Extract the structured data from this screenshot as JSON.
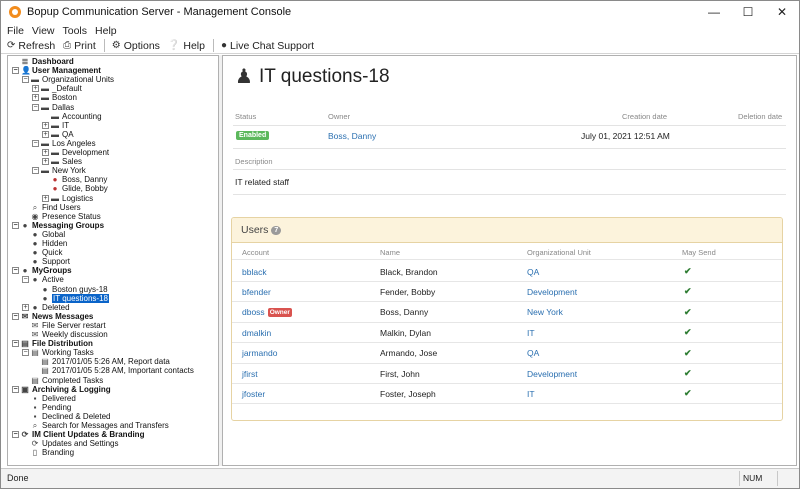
{
  "window": {
    "title": "Bopup Communication Server - Management Console"
  },
  "menu": [
    "File",
    "View",
    "Tools",
    "Help"
  ],
  "toolbar": {
    "refresh": "Refresh",
    "print": "Print",
    "options": "Options",
    "help": "Help",
    "live_chat": "Live Chat Support"
  },
  "tree": [
    {
      "label": "Dashboard",
      "bold": true,
      "icon": "≣",
      "exp": ""
    },
    {
      "label": "User Management",
      "bold": true,
      "icon": "👤",
      "exp": "−"
    },
    {
      "label": "Organizational Units",
      "icon": "▬",
      "exp": "−"
    },
    {
      "label": "_Default",
      "icon": "▬",
      "exp": "+"
    },
    {
      "label": "Boston",
      "icon": "▬",
      "exp": "+"
    },
    {
      "label": "Dallas",
      "icon": "▬",
      "exp": "−"
    },
    {
      "label": "Accounting",
      "icon": "▬",
      "exp": ""
    },
    {
      "label": "IT",
      "icon": "▬",
      "exp": "+"
    },
    {
      "label": "QA",
      "icon": "▬",
      "exp": "+"
    },
    {
      "label": "Los Angeles",
      "icon": "▬",
      "exp": "−"
    },
    {
      "label": "Development",
      "icon": "▬",
      "exp": "+"
    },
    {
      "label": "Sales",
      "icon": "▬",
      "exp": "+"
    },
    {
      "label": "New York",
      "icon": "▬",
      "exp": "−"
    },
    {
      "label": "Boss, Danny",
      "icon": "●",
      "exp": "",
      "red": true
    },
    {
      "label": "Glide, Bobby",
      "icon": "●",
      "exp": "",
      "red": true
    },
    {
      "label": "Logistics",
      "icon": "▬",
      "exp": "+"
    },
    {
      "label": "Find Users",
      "icon": "⌕",
      "exp": ""
    },
    {
      "label": "Presence Status",
      "icon": "◉",
      "exp": ""
    },
    {
      "label": "Messaging Groups",
      "bold": true,
      "icon": "●",
      "exp": "−"
    },
    {
      "label": "Global",
      "icon": "●",
      "exp": ""
    },
    {
      "label": "Hidden",
      "icon": "●",
      "exp": ""
    },
    {
      "label": "Quick",
      "icon": "●",
      "exp": ""
    },
    {
      "label": "Support",
      "icon": "●",
      "exp": ""
    },
    {
      "label": "MyGroups",
      "bold": true,
      "icon": "●",
      "exp": "−"
    },
    {
      "label": "Active",
      "icon": "●",
      "exp": "−"
    },
    {
      "label": "Boston guys-18",
      "icon": "●",
      "exp": ""
    },
    {
      "label": "IT questions-18",
      "icon": "●",
      "exp": "",
      "selected": true
    },
    {
      "label": "Deleted",
      "icon": "●",
      "exp": "+"
    },
    {
      "label": "News Messages",
      "bold": true,
      "icon": "✉",
      "exp": "−"
    },
    {
      "label": "File Server restart",
      "icon": "✉",
      "exp": ""
    },
    {
      "label": "Weekly discussion",
      "icon": "✉",
      "exp": ""
    },
    {
      "label": "File Distribution",
      "bold": true,
      "icon": "▤",
      "exp": "−"
    },
    {
      "label": "Working Tasks",
      "icon": "▤",
      "exp": "−"
    },
    {
      "label": "2017/01/05 5:26 AM, Report data",
      "icon": "▤",
      "exp": ""
    },
    {
      "label": "2017/01/05 5:28 AM, Important contacts",
      "icon": "▤",
      "exp": ""
    },
    {
      "label": "Completed Tasks",
      "icon": "▤",
      "exp": ""
    },
    {
      "label": "Archiving & Logging",
      "bold": true,
      "icon": "▣",
      "exp": "−"
    },
    {
      "label": "Delivered",
      "icon": "▪",
      "exp": ""
    },
    {
      "label": "Pending",
      "icon": "▪",
      "exp": ""
    },
    {
      "label": "Declined & Deleted",
      "icon": "▪",
      "exp": ""
    },
    {
      "label": "Search for Messages and Transfers",
      "icon": "⌕",
      "exp": ""
    },
    {
      "label": "IM Client Updates & Branding",
      "bold": true,
      "icon": "⟳",
      "exp": "−"
    },
    {
      "label": "Updates and Settings",
      "icon": "⟳",
      "exp": ""
    },
    {
      "label": "Branding",
      "icon": "▯",
      "exp": ""
    }
  ],
  "detail": {
    "title": "IT questions-18",
    "headers": {
      "status": "Status",
      "owner": "Owner",
      "creation": "Creation date",
      "deletion": "Deletion date",
      "description": "Description"
    },
    "status": "Enabled",
    "owner": "Boss, Danny",
    "creation_date": "July 01, 2021 12:51 AM",
    "description": "IT related staff"
  },
  "users_panel": {
    "title": "Users",
    "count": "7",
    "columns": [
      "Account",
      "Name",
      "Organizational Unit",
      "May Send"
    ],
    "owner_badge": "Owner",
    "rows": [
      {
        "account": "bblack",
        "name": "Black, Brandon",
        "ou": "QA",
        "may_send": "✔"
      },
      {
        "account": "bfender",
        "name": "Fender, Bobby",
        "ou": "Development",
        "may_send": "✔"
      },
      {
        "account": "dboss",
        "name": "Boss, Danny",
        "ou": "New York",
        "may_send": "✔",
        "owner": true
      },
      {
        "account": "dmalkin",
        "name": "Malkin, Dylan",
        "ou": "IT",
        "may_send": "✔"
      },
      {
        "account": "jarmando",
        "name": "Armando, Jose",
        "ou": "QA",
        "may_send": "✔"
      },
      {
        "account": "jfirst",
        "name": "First, John",
        "ou": "Development",
        "may_send": "✔"
      },
      {
        "account": "jfoster",
        "name": "Foster, Joseph",
        "ou": "IT",
        "may_send": "✔"
      }
    ]
  },
  "statusbar": {
    "left": "Done",
    "num": "NUM"
  },
  "colors": {
    "accent": "#2a6fb0",
    "enabled": "#5cb85c",
    "owner": "#d9534f",
    "panel_head": "#fcf3dc",
    "selection": "#0a64c9"
  }
}
